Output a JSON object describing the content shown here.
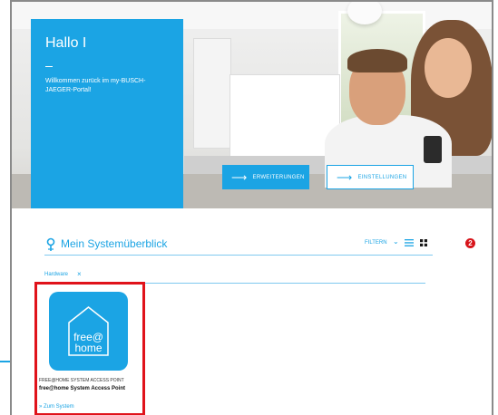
{
  "welcome": {
    "title": "Hallo I",
    "text": "Willkommen zurück im my-BUSCH-JAEGER-Portal!"
  },
  "hero_buttons": {
    "extensions": "ERWEITERUNGEN",
    "settings": "EINSTELLUNGEN",
    "arrow": "⟶"
  },
  "overview": {
    "title": "Mein Systemüberblick",
    "filter": "FILTERN",
    "chevron": "⌄",
    "badge": "2"
  },
  "filter_tag": {
    "label": "Hardware",
    "remove": "×"
  },
  "card": {
    "logo_line1": "free@",
    "logo_line2": "home",
    "type": "FREE@HOME SYSTEM ACCESS POINT",
    "name": "free@home System Access Point",
    "link": "» Zum System"
  },
  "colors": {
    "accent": "#1ba4e4",
    "highlight_border": "#e0131b",
    "badge": "#d7141a"
  },
  "icons": [
    "location-pin-icon",
    "chevron-down-icon",
    "list-view-icon",
    "grid-view-icon",
    "arrow-right-icon",
    "close-icon",
    "house-logo-icon"
  ]
}
